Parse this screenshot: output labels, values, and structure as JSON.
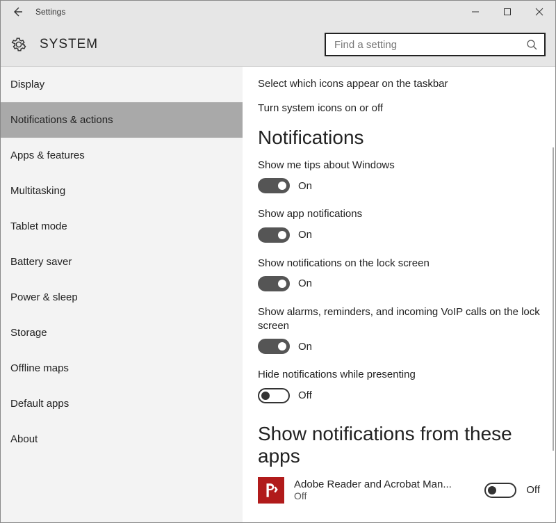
{
  "titlebar": {
    "title": "Settings"
  },
  "header": {
    "page_title": "SYSTEM",
    "search_placeholder": "Find a setting"
  },
  "sidebar": {
    "items": [
      {
        "label": "Display",
        "active": false
      },
      {
        "label": "Notifications & actions",
        "active": true
      },
      {
        "label": "Apps & features",
        "active": false
      },
      {
        "label": "Multitasking",
        "active": false
      },
      {
        "label": "Tablet mode",
        "active": false
      },
      {
        "label": "Battery saver",
        "active": false
      },
      {
        "label": "Power & sleep",
        "active": false
      },
      {
        "label": "Storage",
        "active": false
      },
      {
        "label": "Offline maps",
        "active": false
      },
      {
        "label": "Default apps",
        "active": false
      },
      {
        "label": "About",
        "active": false
      }
    ]
  },
  "main": {
    "taskbar_link": "Select which icons appear on the taskbar",
    "sysicons_link": "Turn system icons on or off",
    "notifications_heading": "Notifications",
    "toggle_on_text": "On",
    "toggle_off_text": "Off",
    "settings": [
      {
        "label": "Show me tips about Windows",
        "on": true
      },
      {
        "label": "Show app notifications",
        "on": true
      },
      {
        "label": "Show notifications on the lock screen",
        "on": true
      },
      {
        "label": "Show alarms, reminders, and incoming VoIP calls on the lock screen",
        "on": true
      },
      {
        "label": "Hide notifications while presenting",
        "on": false
      }
    ],
    "apps_heading": "Show notifications from these apps",
    "apps": [
      {
        "name": "Adobe Reader and Acrobat Man...",
        "sub": "Off",
        "on": false,
        "icon": "adobe-icon"
      }
    ]
  }
}
